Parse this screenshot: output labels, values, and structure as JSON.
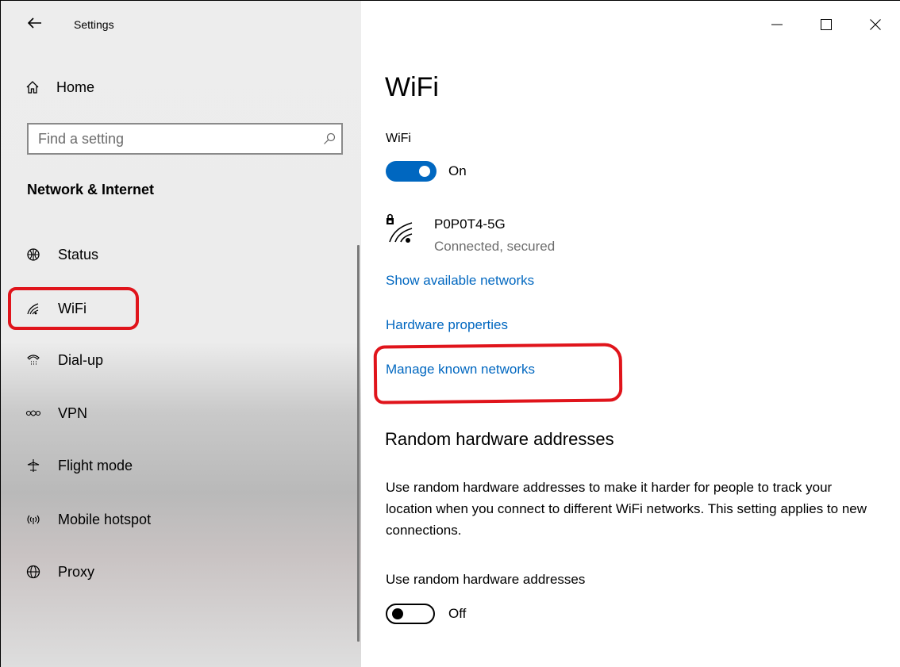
{
  "titlebar": {
    "back_icon": "back-arrow-icon",
    "app_title": "Settings"
  },
  "window_controls": {
    "minimize": "—",
    "maximize": "☐",
    "close": "✕"
  },
  "sidebar": {
    "home_label": "Home",
    "search_placeholder": "Find a setting",
    "section_title": "Network & Internet",
    "items": [
      {
        "label": "Status",
        "icon": "globe-status-icon"
      },
      {
        "label": "WiFi",
        "icon": "wifi-icon"
      },
      {
        "label": "Dial-up",
        "icon": "dialup-icon"
      },
      {
        "label": "VPN",
        "icon": "vpn-icon"
      },
      {
        "label": "Flight mode",
        "icon": "airplane-icon"
      },
      {
        "label": "Mobile hotspot",
        "icon": "hotspot-icon"
      },
      {
        "label": "Proxy",
        "icon": "globe-icon"
      }
    ]
  },
  "main": {
    "page_title": "WiFi",
    "wifi_label": "WiFi",
    "wifi_state": "On",
    "network": {
      "name": "P0P0T4-5G",
      "status": "Connected, secured"
    },
    "links": {
      "show_networks": "Show available networks",
      "hardware_properties": "Hardware properties",
      "manage_known": "Manage known networks"
    },
    "random_section_title": "Random hardware addresses",
    "random_description": "Use random hardware addresses to make it harder for people to track your location when you connect to different WiFi networks. This setting applies to new connections.",
    "random_label": "Use random hardware addresses",
    "random_state": "Off"
  },
  "colors": {
    "accent": "#0067c0",
    "annotation": "#e0141b"
  }
}
